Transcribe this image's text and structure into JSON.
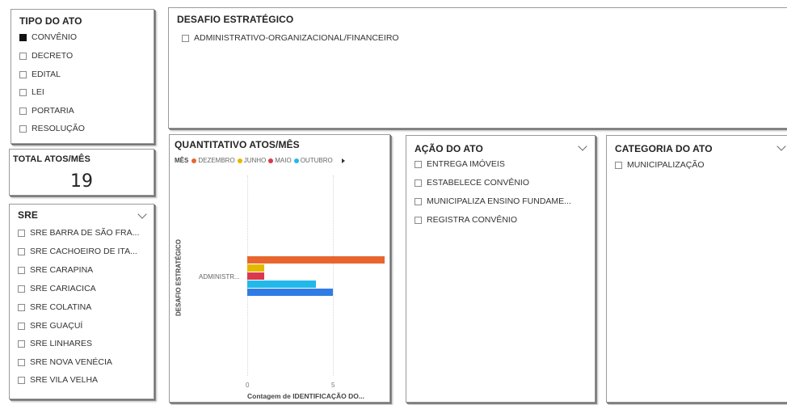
{
  "tipo_do_ato": {
    "title": "TIPO DO ATO",
    "items": [
      {
        "label": "CONVÊNIO",
        "checked": true
      },
      {
        "label": "DECRETO",
        "checked": false
      },
      {
        "label": "EDITAL",
        "checked": false
      },
      {
        "label": "LEI",
        "checked": false
      },
      {
        "label": "PORTARIA",
        "checked": false
      },
      {
        "label": "RESOLUÇÃO",
        "checked": false
      }
    ]
  },
  "desafio_estrategico": {
    "title": "DESAFIO ESTRATÉGICO",
    "items": [
      {
        "label": "ADMINISTRATIVO-ORGANIZACIONAL/FINANCEIRO",
        "checked": false
      }
    ]
  },
  "total_atos": {
    "title": "TOTAL ATOS/MÊS",
    "value": "19"
  },
  "sre": {
    "title": "SRE",
    "items": [
      {
        "label": "SRE BARRA DE SÃO FRA..."
      },
      {
        "label": "SRE CACHOEIRO DE ITA..."
      },
      {
        "label": "SRE CARAPINA"
      },
      {
        "label": "SRE CARIACICA"
      },
      {
        "label": "SRE COLATINA"
      },
      {
        "label": "SRE GUAÇUÍ"
      },
      {
        "label": "SRE LINHARES"
      },
      {
        "label": "SRE NOVA VENÉCIA"
      },
      {
        "label": "SRE VILA VELHA"
      }
    ]
  },
  "quantitativo": {
    "title": "QUANTITATIVO ATOS/MÊS",
    "legend_label": "MÊS",
    "ylabel": "DESAFIO ESTRATÉGICO",
    "xlabel": "Contagem de IDENTIFICAÇÃO DO...",
    "category_label": "ADMINISTR...",
    "tick_0": "0",
    "tick_5": "5"
  },
  "chart_data": {
    "type": "bar",
    "orientation": "horizontal",
    "title": "QUANTITATIVO ATOS/MÊS",
    "categories": [
      "ADMINISTR..."
    ],
    "xlabel": "Contagem de IDENTIFICAÇÃO DO...",
    "ylabel": "DESAFIO ESTRATÉGICO",
    "xlim": [
      0,
      8
    ],
    "xticks": [
      0,
      5
    ],
    "grid": true,
    "legend_title": "MÊS",
    "legend_position": "top",
    "series": [
      {
        "name": "DEZEMBRO",
        "color": "#e8662e",
        "values": [
          8
        ]
      },
      {
        "name": "JUNHO",
        "color": "#e5b800",
        "values": [
          1
        ]
      },
      {
        "name": "MAIO",
        "color": "#d9394c",
        "values": [
          1
        ]
      },
      {
        "name": "OUTUBRO",
        "color": "#22b8ea",
        "values": [
          4
        ]
      },
      {
        "name": "",
        "color": "#2f7ce6",
        "values": [
          5
        ]
      }
    ]
  },
  "acao_do_ato": {
    "title": "AÇÃO DO ATO",
    "items": [
      {
        "label": "ENTREGA IMÓVEIS"
      },
      {
        "label": "ESTABELECE CONVÊNIO"
      },
      {
        "label": "MUNICIPALIZA ENSINO FUNDAME..."
      },
      {
        "label": "REGISTRA CONVÊNIO"
      }
    ]
  },
  "categoria_do_ato": {
    "title": "CATEGORIA DO ATO",
    "items": [
      {
        "label": "MUNICIPALIZAÇÃO"
      }
    ]
  }
}
